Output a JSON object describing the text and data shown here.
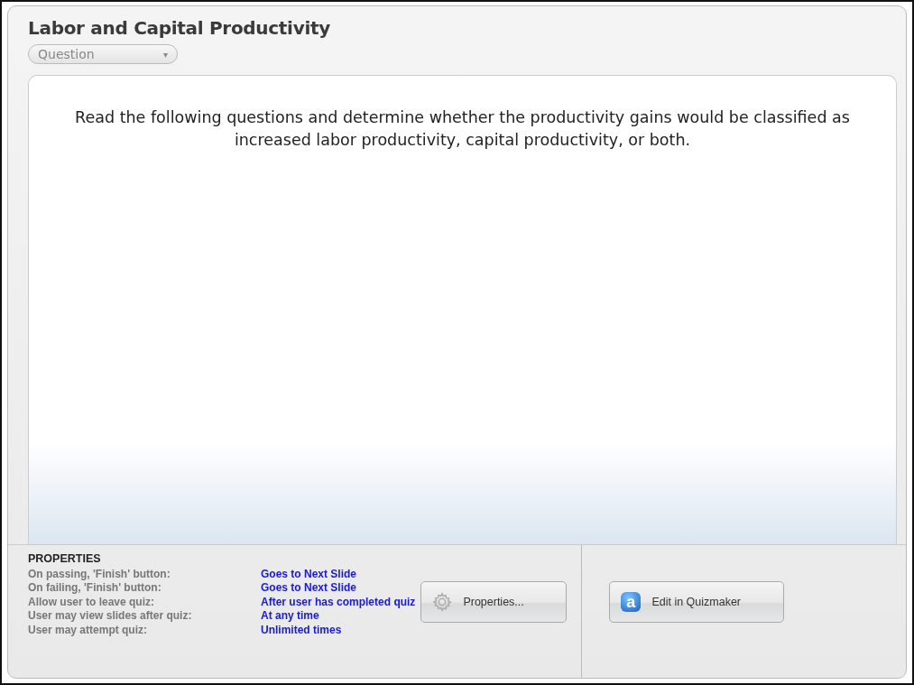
{
  "title": "Labor and Capital Productivity",
  "view_dropdown": {
    "value": "Question",
    "caret": "▾"
  },
  "question_text": "Read the following questions and determine whether the productivity gains would be classified as increased labor productivity, capital productivity, or both.",
  "properties": {
    "heading": "PROPERTIES",
    "rows": [
      {
        "label": "On passing, 'Finish' button:",
        "value": "Goes to Next Slide"
      },
      {
        "label": "On failing, 'Finish' button:",
        "value": "Goes to Next Slide"
      },
      {
        "label": "Allow user to leave quiz:",
        "value": "After user has completed quiz"
      },
      {
        "label": "User may view slides after quiz:",
        "value": "At any time"
      },
      {
        "label": "User may attempt quiz:",
        "value": "Unlimited times"
      }
    ]
  },
  "buttons": [
    {
      "kind": "properties",
      "label": "Properties..."
    },
    {
      "kind": "quizmaker",
      "label": "Edit in Quizmaker",
      "icon_letter": "a"
    }
  ]
}
